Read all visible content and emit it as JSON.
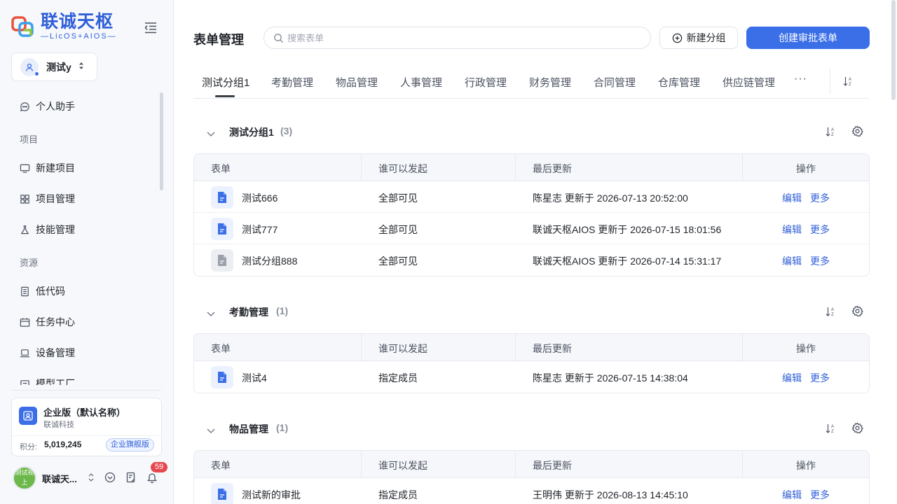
{
  "brand": {
    "title": "联诚天枢",
    "subtitle": "—LicOS+AIOS—",
    "colors": {
      "primary": "#3a6fe7",
      "danger": "#e5484d"
    }
  },
  "workspace": {
    "label": "测试y"
  },
  "nav": {
    "assistant": "个人助手",
    "section_project": "项目",
    "new_project": "新建项目",
    "project_mgmt": "项目管理",
    "skill_mgmt": "技能管理",
    "section_resource": "资源",
    "lowcode": "低代码",
    "task_center": "任务中心",
    "device_mgmt": "设备管理",
    "model_factory": "模型工厂"
  },
  "org": {
    "name": "企业版（默认名称）",
    "company": "联诚科技",
    "points_label": "积分:",
    "points_value": "5,019,245",
    "plan": "企业旗舰版"
  },
  "user": {
    "avatar_text": "测试视上",
    "name": "联诚天...",
    "notifications": "59"
  },
  "header": {
    "title": "表单管理",
    "search_placeholder": "搜索表单",
    "new_group": "新建分组",
    "create_form": "创建审批表单"
  },
  "tabs": [
    "测试分组1",
    "考勤管理",
    "物品管理",
    "人事管理",
    "行政管理",
    "财务管理",
    "合同管理",
    "仓库管理",
    "供应链管理"
  ],
  "tab_more": "···",
  "table_headers": {
    "form": "表单",
    "who": "谁可以发起",
    "updated": "最后更新",
    "actions": "操作"
  },
  "actions": {
    "edit": "编辑",
    "more": "更多"
  },
  "sections": [
    {
      "title": "测试分组1",
      "count": "(3)",
      "rows": [
        {
          "name": "测试666",
          "who": "全部可见",
          "updated": "陈星志 更新于 2026-07-13 20:52:00",
          "icon": "doc-blue-icon"
        },
        {
          "name": "测试777",
          "who": "全部可见",
          "updated": "联诚天枢AIOS 更新于 2026-07-15 18:01:56",
          "icon": "doc-blue-icon"
        },
        {
          "name": "测试分组888",
          "who": "全部可见",
          "updated": "联诚天枢AIOS 更新于 2026-07-14 15:31:17",
          "icon": "doc-grey-icon"
        }
      ]
    },
    {
      "title": "考勤管理",
      "count": "(1)",
      "rows": [
        {
          "name": "测试4",
          "who": "指定成员",
          "updated": "陈星志 更新于 2026-07-15 14:38:04",
          "icon": "doc-blue-icon"
        }
      ]
    },
    {
      "title": "物品管理",
      "count": "(1)",
      "rows": [
        {
          "name": "测试新的审批",
          "who": "指定成员",
          "updated": "王明伟 更新于 2026-08-13 14:45:10",
          "icon": "doc-blue-icon"
        }
      ]
    }
  ]
}
